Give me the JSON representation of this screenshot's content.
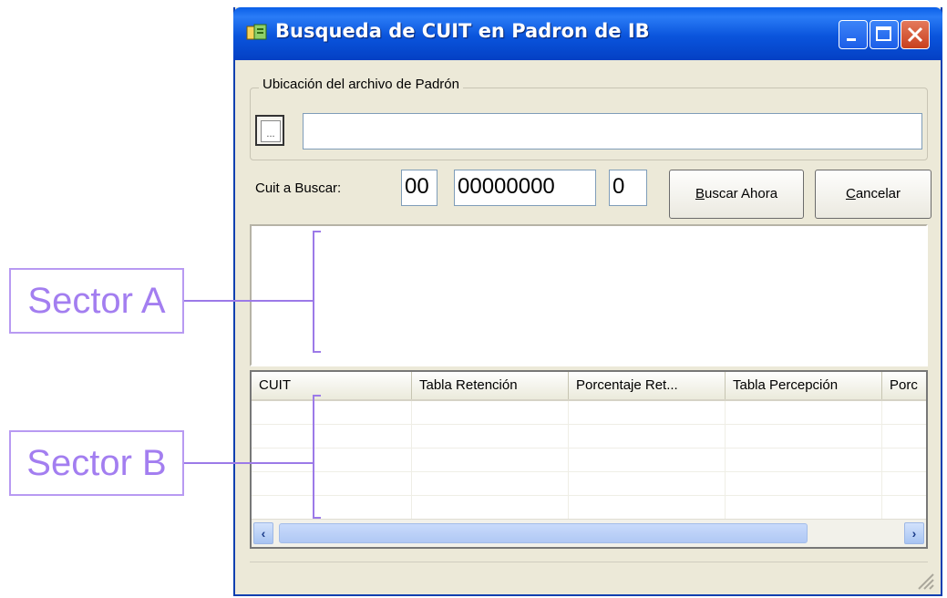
{
  "window": {
    "title": "Busqueda de CUIT en Padron de IB",
    "controls": [
      "minimize-icon",
      "maximize-icon",
      "close-icon"
    ]
  },
  "file_group": {
    "legend": "Ubicación del archivo de Padrón",
    "browse_label": "...",
    "path_value": ""
  },
  "search": {
    "label": "Cuit a Buscar:",
    "prefix": "00",
    "number": "00000000",
    "check_digit": "0",
    "buscar_hot": "B",
    "buscar_rest": "uscar Ahora",
    "cancel_hot": "C",
    "cancel_rest": "ancelar"
  },
  "results": {
    "columns": [
      "CUIT",
      "Tabla Retención",
      "Porcentaje Ret...",
      "Tabla Percepción",
      "Porc"
    ],
    "rows": 5
  },
  "annotations": {
    "sector_a": "Sector A",
    "sector_b": "Sector B"
  },
  "colors": {
    "titlebar": "#0a54dc",
    "window_bg": "#ece9d8",
    "annotation": "#a37ef0"
  }
}
